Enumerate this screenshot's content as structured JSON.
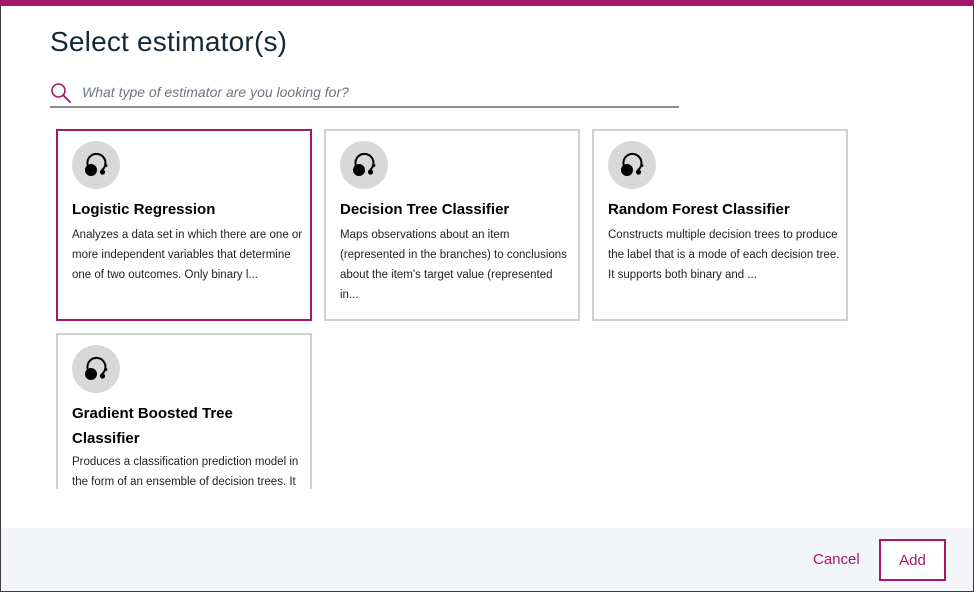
{
  "dialog": {
    "title": "Select estimator(s)"
  },
  "search": {
    "placeholder": "What type of estimator are you looking for?",
    "value": "",
    "icon": "search-icon"
  },
  "estimators": [
    {
      "name": "Logistic Regression",
      "description": "Analyzes a data set in which there are one or more independent variables that determine one of two outcomes. Only binary l...",
      "selected": true,
      "icon": "estimator-icon"
    },
    {
      "name": "Decision Tree Classifier",
      "description": "Maps observations about an item (represented in the branches) to conclusions about the item's target value (represented in...",
      "selected": false,
      "icon": "estimator-icon"
    },
    {
      "name": "Random Forest Classifier",
      "description": "Constructs multiple decision trees to produce the label that is a mode of each decision tree. It supports both binary and ...",
      "selected": false,
      "icon": "estimator-icon"
    },
    {
      "name": "Gradient Boosted Tree Classifier",
      "description": "Produces a classification prediction model in the form of an ensemble of decision trees. It",
      "selected": false,
      "icon": "estimator-icon"
    }
  ],
  "footer": {
    "cancel_label": "Cancel",
    "add_label": "Add"
  },
  "colors": {
    "accent": "#a5186c",
    "card_border": "#d0d0d0",
    "icon_bg": "#d8d8d8",
    "footer_bg": "#f4f5f8"
  }
}
